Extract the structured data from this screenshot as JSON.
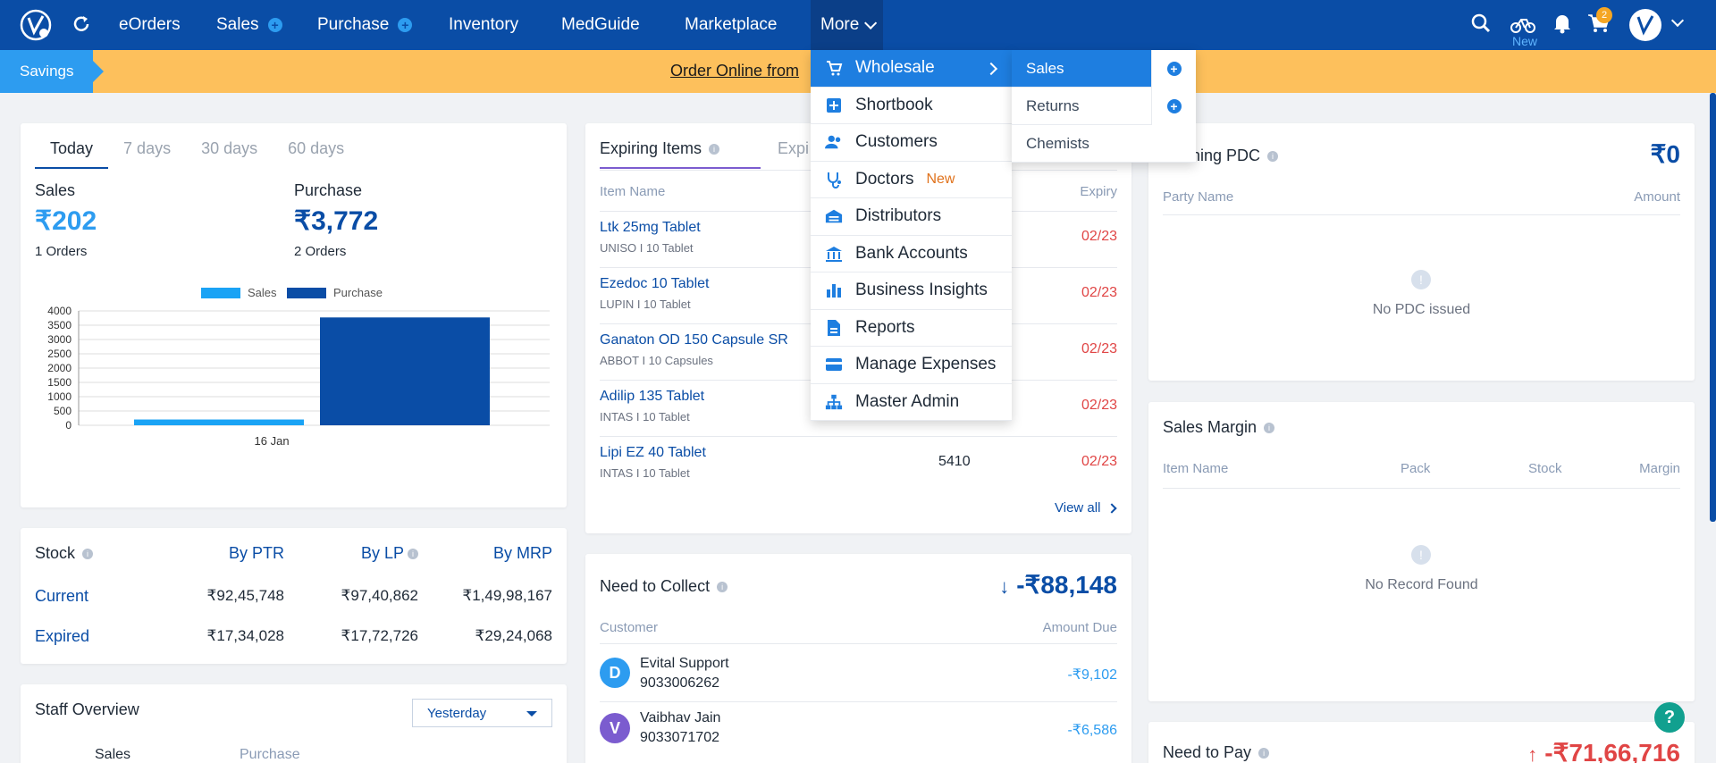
{
  "nav": {
    "items": [
      "eOrders",
      "Sales",
      "Purchase",
      "Inventory",
      "MedGuide",
      "Marketplace",
      "More"
    ],
    "new_label": "New",
    "cart_count": "2"
  },
  "banner": {
    "tag": "Savings",
    "text": "Order Online from"
  },
  "more_menu": {
    "items": [
      {
        "label": "Wholesale",
        "icon": "wholesale-icon"
      },
      {
        "label": "Shortbook",
        "icon": "shortbook-icon"
      },
      {
        "label": "Customers",
        "icon": "customers-icon"
      },
      {
        "label": "Doctors",
        "icon": "doctors-icon",
        "badge": "New"
      },
      {
        "label": "Distributors",
        "icon": "distributors-icon"
      },
      {
        "label": "Bank Accounts",
        "icon": "bank-icon"
      },
      {
        "label": "Business Insights",
        "icon": "insights-icon"
      },
      {
        "label": "Reports",
        "icon": "reports-icon"
      },
      {
        "label": "Manage Expenses",
        "icon": "expenses-icon"
      },
      {
        "label": "Master Admin",
        "icon": "admin-icon"
      }
    ],
    "submenu": [
      "Sales",
      "Returns",
      "Chemists"
    ]
  },
  "today": {
    "tabs": [
      "Today",
      "7 days",
      "30 days",
      "60 days"
    ],
    "sales_label": "Sales",
    "sales_value": "₹202",
    "sales_orders": "1 Orders",
    "purchase_label": "Purchase",
    "purchase_value": "₹3,772",
    "purchase_orders": "2 Orders"
  },
  "chart_data": {
    "type": "bar",
    "categories": [
      "16 Jan"
    ],
    "series": [
      {
        "name": "Sales",
        "values": [
          202
        ],
        "color": "#1aa3f5"
      },
      {
        "name": "Purchase",
        "values": [
          3772
        ],
        "color": "#0a4da6"
      }
    ],
    "ylim": [
      0,
      4000
    ],
    "yticks": [
      "0",
      "500",
      "1000",
      "1500",
      "2000",
      "2500",
      "3000",
      "3500",
      "4000"
    ],
    "legend": "top"
  },
  "stock": {
    "title": "Stock",
    "headers": [
      "By PTR",
      "By LP",
      "By MRP"
    ],
    "rows": [
      {
        "label": "Current",
        "values": [
          "₹92,45,748",
          "₹97,40,862",
          "₹1,49,98,167"
        ]
      },
      {
        "label": "Expired",
        "values": [
          "₹17,34,028",
          "₹17,72,726",
          "₹29,24,068"
        ]
      }
    ]
  },
  "staff": {
    "title": "Staff Overview",
    "select": "Yesterday",
    "cols": [
      "Sales",
      "Purchase"
    ]
  },
  "expiring": {
    "tabs": [
      "Expiring Items",
      "Expi"
    ],
    "col_item": "Item Name",
    "col_expiry": "Expiry",
    "rows": [
      {
        "name": "Ltk 25mg Tablet",
        "sub": "UNISO I 10 Tablet",
        "qty": "",
        "expiry": "02/23"
      },
      {
        "name": "Ezedoc 10 Tablet",
        "sub": "LUPIN I 10 Tablet",
        "qty": "",
        "expiry": "02/23"
      },
      {
        "name": "Ganaton OD 150 Capsule SR",
        "sub": "ABBOT I 10 Capsules",
        "qty": "",
        "expiry": "02/23"
      },
      {
        "name": "Adilip 135 Tablet",
        "sub": "INTAS I 10 Tablet",
        "qty": "",
        "expiry": "02/23"
      },
      {
        "name": "Lipi EZ 40 Tablet",
        "sub": "INTAS I 10 Tablet",
        "qty": "5410",
        "expiry": "02/23"
      }
    ],
    "view_all": "View all"
  },
  "collect": {
    "title": "Need to Collect",
    "total": "-₹88,148",
    "col_customer": "Customer",
    "col_amount": "Amount Due",
    "rows": [
      {
        "initial": "D",
        "name": "Evital Support",
        "phone": "9033006262",
        "amount": "-₹9,102"
      },
      {
        "initial": "V",
        "name": "Vaibhav Jain",
        "phone": "9033071702",
        "amount": "-₹6,586"
      }
    ]
  },
  "pdc": {
    "title": "coming PDC",
    "total": "₹0",
    "col_party": "Party Name",
    "col_amount": "Amount",
    "empty": "No PDC issued"
  },
  "margin": {
    "title": "Sales Margin",
    "cols": [
      "Item Name",
      "Pack",
      "Stock",
      "Margin"
    ],
    "empty": "No Record Found"
  },
  "pay": {
    "title": "Need to Pay",
    "total": "-₹71,66,716"
  }
}
